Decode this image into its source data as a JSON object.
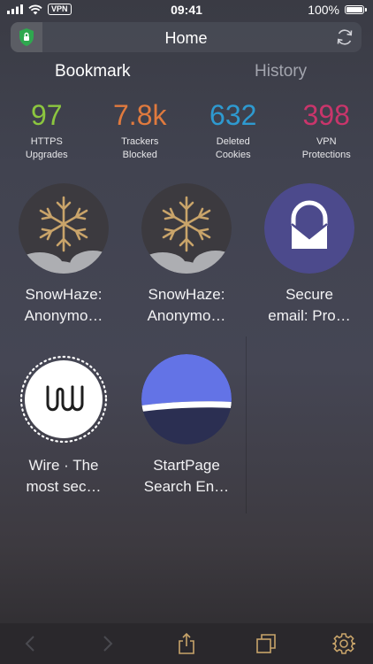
{
  "status_bar": {
    "time": "09:41",
    "battery": "100%",
    "vpn": "VPN"
  },
  "url_bar": {
    "title": "Home",
    "shield_icon": "shield-icon",
    "reload_icon": "reload-icon"
  },
  "tabs": [
    {
      "label": "Bookmark",
      "selected": true
    },
    {
      "label": "History",
      "selected": false
    }
  ],
  "stats": [
    {
      "value": "97",
      "label": "HTTPS\nUpgrades",
      "color": "#8cc63f"
    },
    {
      "value": "7.8k",
      "label": "Trackers\nBlocked",
      "color": "#e07a3e"
    },
    {
      "value": "632",
      "label": "Deleted\nCookies",
      "color": "#2e9ad0"
    },
    {
      "value": "398",
      "label": "VPN\nProtections",
      "color": "#c9356b"
    }
  ],
  "bookmarks": [
    {
      "label": "SnowHaze:\nAnonymo…",
      "icon": "snowhaze-icon"
    },
    {
      "label": "SnowHaze:\nAnonymo…",
      "icon": "snowhaze-icon"
    },
    {
      "label": "Secure\nemail: Pro…",
      "icon": "protonmail-icon"
    },
    {
      "label": "Wire · The\nmost sec…",
      "icon": "wire-icon"
    },
    {
      "label": "StartPage\nSearch En…",
      "icon": "startpage-icon"
    }
  ],
  "toolbar": [
    "back-icon",
    "forward-icon",
    "share-icon",
    "tabs-icon",
    "settings-icon"
  ]
}
